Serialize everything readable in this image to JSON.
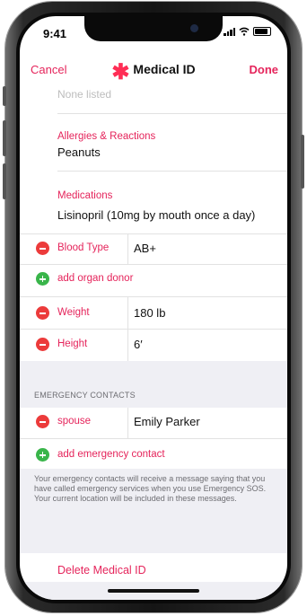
{
  "status_bar": {
    "time": "9:41"
  },
  "nav": {
    "cancel": "Cancel",
    "title": "Medical ID",
    "title_icon": "asterisk-icon",
    "done": "Done",
    "accent_color": "#e5245b"
  },
  "medical": {
    "previous_value": "None listed",
    "allergies_label": "Allergies & Reactions",
    "allergies_value": "Peanuts",
    "medications_label": "Medications",
    "medications_value": "Lisinopril (10mg by mouth once a day)",
    "rows": [
      {
        "label": "Blood Type",
        "value": "AB+"
      },
      {
        "label": "add organ donor",
        "value": ""
      },
      {
        "label": "Weight",
        "value": "180 lb"
      },
      {
        "label": "Height",
        "value": "6′"
      }
    ]
  },
  "contacts": {
    "header": "EMERGENCY CONTACTS",
    "items": [
      {
        "relation": "spouse",
        "name": "Emily Parker"
      }
    ],
    "add_label": "add emergency contact",
    "note": "Your emergency contacts will receive a message saying that you have called emergency services when you use Emergency SOS. Your current location will be included in these messages."
  },
  "delete_label": "Delete Medical ID"
}
